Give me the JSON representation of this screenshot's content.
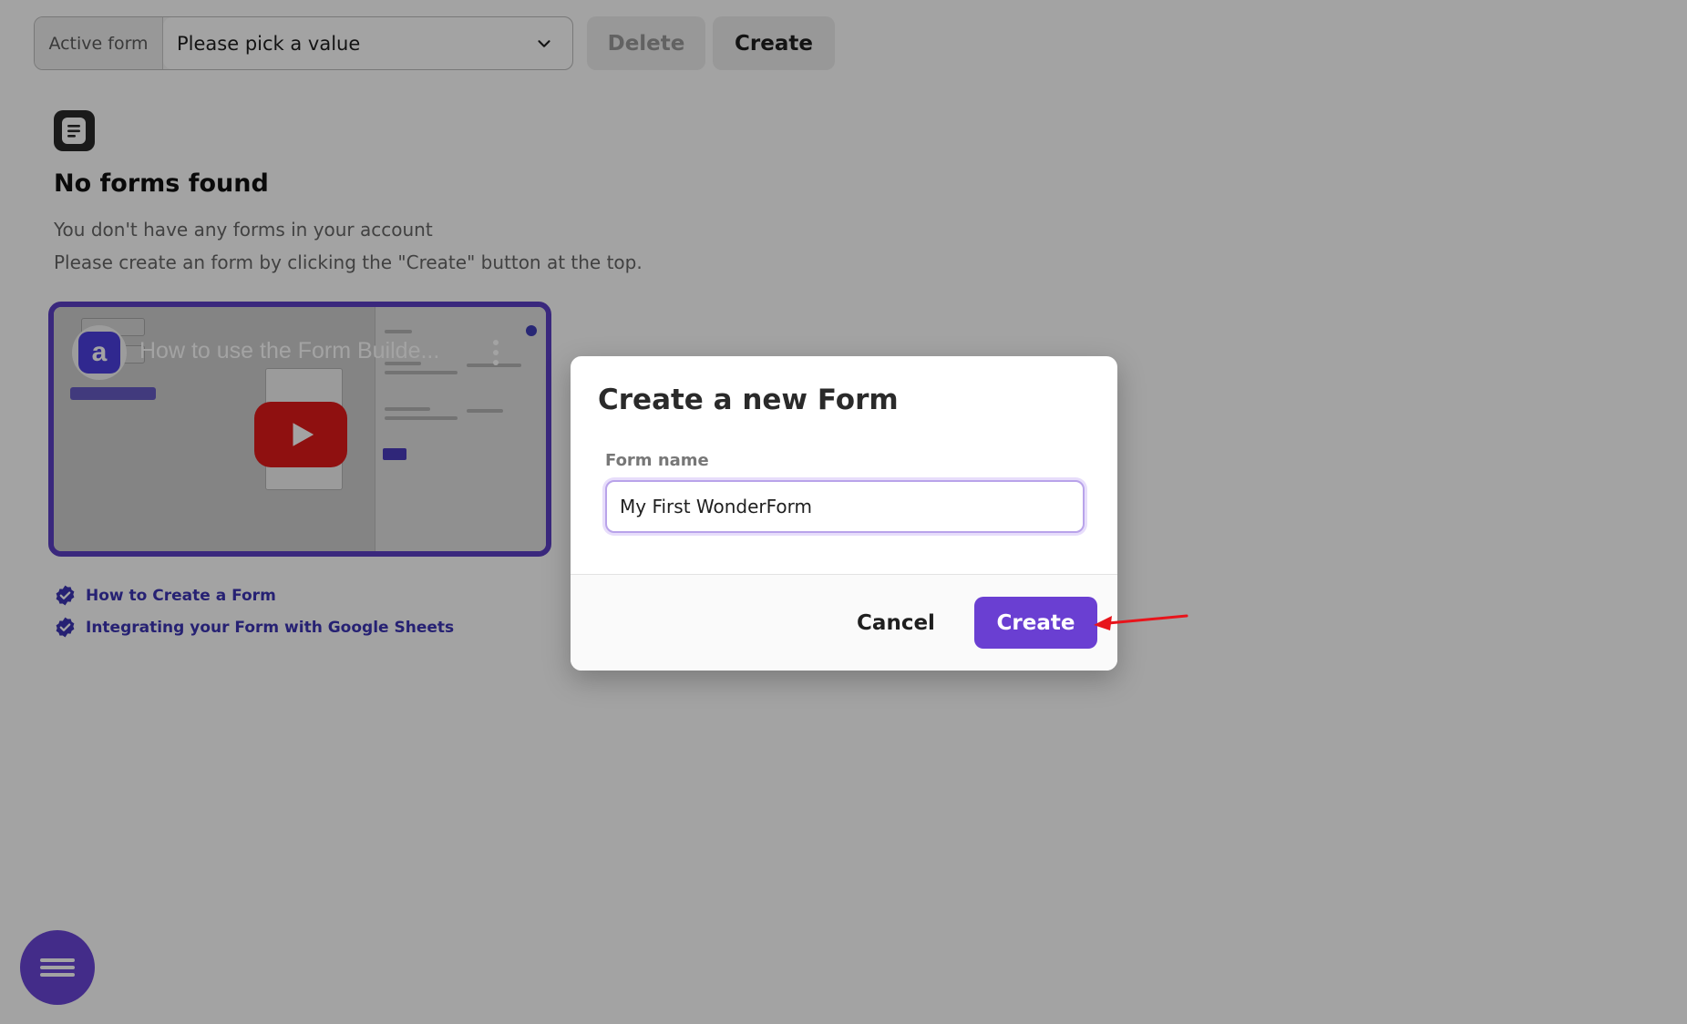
{
  "toolbar": {
    "active_form_label": "Active form",
    "select_value": "Please pick a value",
    "delete_label": "Delete",
    "create_label": "Create"
  },
  "empty_state": {
    "title": "No forms found",
    "line1": "You don't have any forms in your account",
    "line2": "Please create an form by clicking the \"Create\" button at the top."
  },
  "video": {
    "title": "How to use the Form Builde...",
    "channel_initial": "a"
  },
  "links": [
    {
      "label": "How to Create a Form"
    },
    {
      "label": "Integrating your Form with Google Sheets"
    }
  ],
  "modal": {
    "title": "Create a new Form",
    "field_label": "Form name",
    "field_value": "My First WonderForm",
    "cancel_label": "Cancel",
    "create_label": "Create"
  },
  "colors": {
    "accent": "#6a3fd2",
    "link": "#3c35b4",
    "annotation_arrow": "#e8141b",
    "youtube_red": "#e01919"
  }
}
